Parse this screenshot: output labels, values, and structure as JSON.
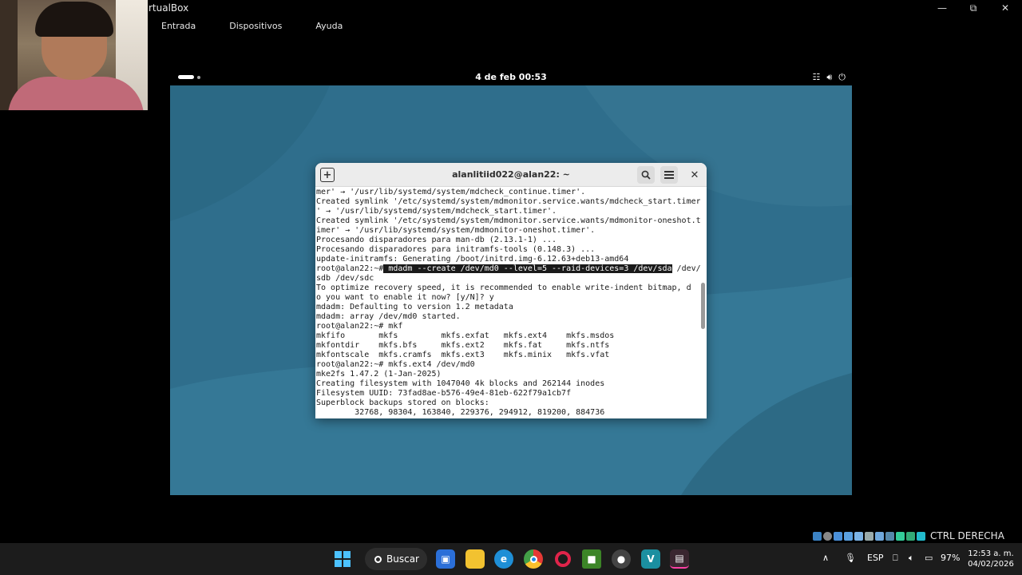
{
  "host": {
    "title": "VirtualBox",
    "title_visible": "rtualBox",
    "menu": [
      "Entrada",
      "Dispositivos",
      "Ayuda"
    ],
    "host_key_label": "CTRL DERECHA"
  },
  "vm": {
    "clock": "4 de feb  00:53",
    "terminal": {
      "title": "alanlitiid022@alan22: ~",
      "lines": [
        {
          "text": "mer' → '/usr/lib/systemd/system/mdcheck_continue.timer'."
        },
        {
          "text": "Created symlink '/etc/systemd/system/mdmonitor.service.wants/mdcheck_start.timer"
        },
        {
          "text": "' → '/usr/lib/systemd/system/mdcheck_start.timer'."
        },
        {
          "text": "Created symlink '/etc/systemd/system/mdmonitor.service.wants/mdmonitor-oneshot.t"
        },
        {
          "text": "imer' → '/usr/lib/systemd/system/mdmonitor-oneshot.timer'."
        },
        {
          "text": "Procesando disparadores para man-db (2.13.1-1) ..."
        },
        {
          "text": "Procesando disparadores para initramfs-tools (0.148.3) ..."
        },
        {
          "text": "update-initramfs: Generating /boot/initrd.img-6.12.63+deb13-amd64"
        },
        {
          "pre": "root@alan22:~#",
          "hl": " mdadm --create /dev/md0 --level=5 --raid-devices=3 /dev/sda",
          "post": " /dev/"
        },
        {
          "text": "sdb /dev/sdc"
        },
        {
          "text": "To optimize recovery speed, it is recommended to enable write-indent bitmap, d"
        },
        {
          "text": "o you want to enable it now? [y/N]? y"
        },
        {
          "text": "mdadm: Defaulting to version 1.2 metadata"
        },
        {
          "text": "mdadm: array /dev/md0 started."
        },
        {
          "text": "root@alan22:~# mkf"
        },
        {
          "text": "mkfifo       mkfs         mkfs.exfat   mkfs.ext4    mkfs.msdos"
        },
        {
          "text": "mkfontdir    mkfs.bfs     mkfs.ext2    mkfs.fat     mkfs.ntfs"
        },
        {
          "text": "mkfontscale  mkfs.cramfs  mkfs.ext3    mkfs.minix   mkfs.vfat"
        },
        {
          "text": "root@alan22:~# mkfs.ext4 /dev/md0"
        },
        {
          "text": "mke2fs 1.47.2 (1-Jan-2025)"
        },
        {
          "text": "Creating filesystem with 1047040 4k blocks and 262144 inodes"
        },
        {
          "text": "Filesystem UUID: 73fad8ae-b576-49e4-81eb-622f79a1cb7f"
        },
        {
          "text": "Superblock backups stored on blocks:"
        },
        {
          "text": "        32768, 98304, 163840, 229376, 294912, 819200, 884736"
        }
      ]
    }
  },
  "taskbar": {
    "search_label": "Buscar",
    "language": "ESP",
    "battery": "97%",
    "time": "12:53 a. m.",
    "date": "04/02/2026"
  },
  "colors": {
    "vm_background": "#2f6e8c",
    "terminal_bg": "#ffffff",
    "taskbar": "#1c1c1c"
  }
}
